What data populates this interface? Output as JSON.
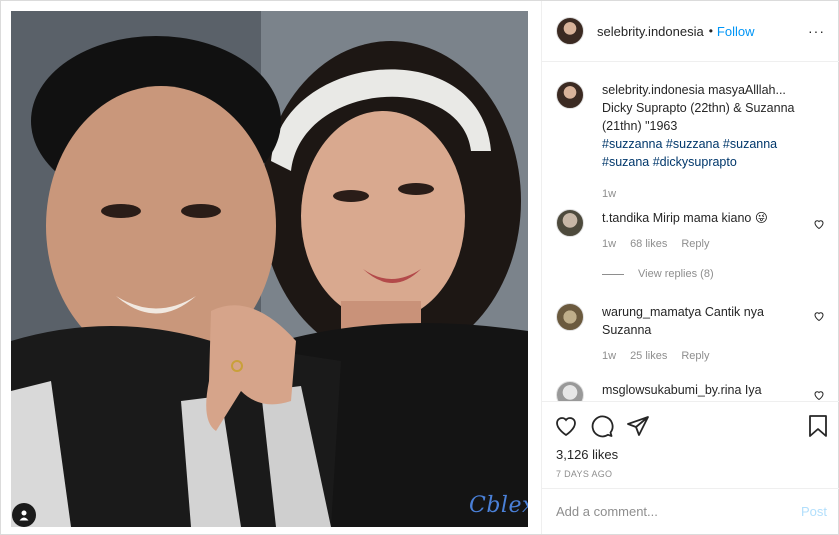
{
  "post": {
    "username": "selebrity.indonesia",
    "separator": "•",
    "follow_label": "Follow",
    "more_label": "···",
    "watermark": "Cblex"
  },
  "caption": {
    "username": "selebrity.indonesia",
    "text": "masyaAlllah... Dicky Suprapto (22thn) & Suzanna (21thn) \"1963",
    "hashtags": "#suzzanna #suzzana #suzanna #suzana #dickysuprapto",
    "time": "1w"
  },
  "comments": [
    {
      "username": "t.tandika",
      "text": "Mirip mama kiano 😜",
      "time": "1w",
      "likes": "68 likes",
      "reply": "Reply",
      "view_replies": "View replies (8)"
    },
    {
      "username": "warung_mamatya",
      "text": "Cantik nya Suzanna",
      "time": "1w",
      "likes": "25 likes",
      "reply": "Reply"
    },
    {
      "username": "msglowsukabumi_by.rina",
      "text": "Iya"
    }
  ],
  "actions": {
    "likes": "3,126 likes",
    "date": "7 DAYS AGO",
    "icons": [
      "heart-icon",
      "comment-icon",
      "share-icon",
      "bookmark-icon"
    ]
  },
  "add_comment": {
    "placeholder": "Add a comment...",
    "post_label": "Post"
  },
  "colors": {
    "accent": "#0095f6",
    "hashtag": "#00376b",
    "muted": "#8e8e8e",
    "post_disabled": "#b2dffc"
  }
}
